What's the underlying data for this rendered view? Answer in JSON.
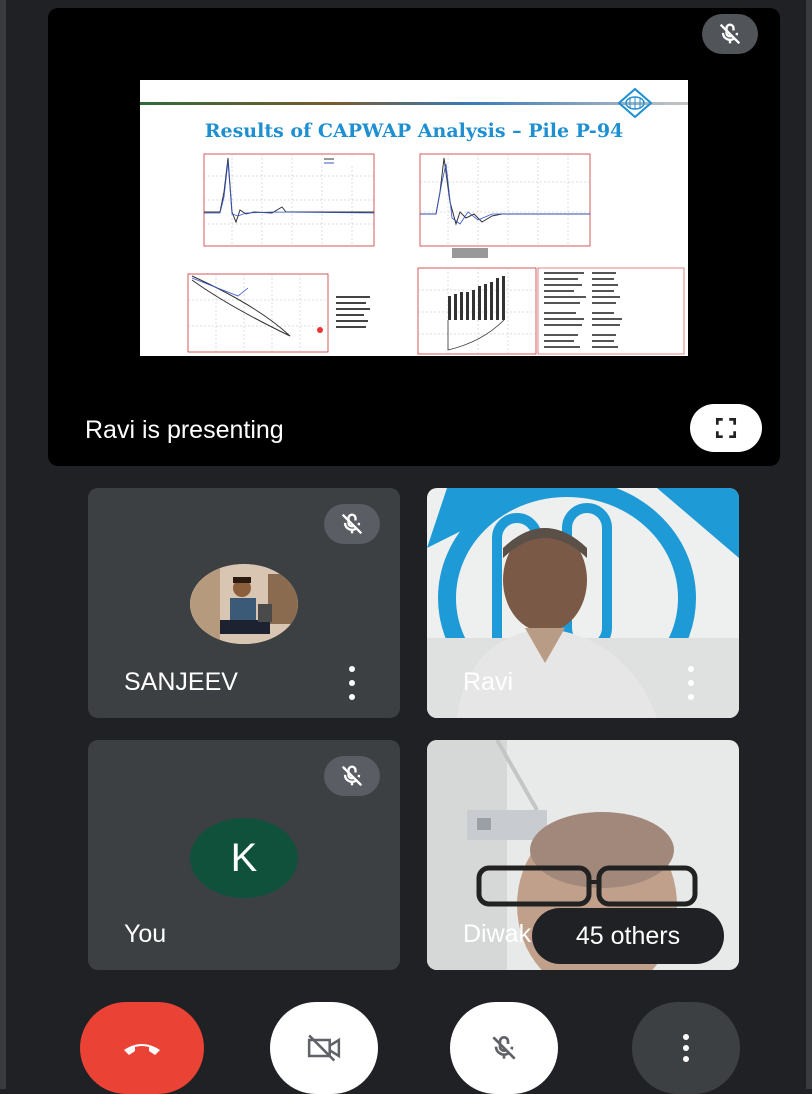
{
  "presentation": {
    "label": "Ravi is presenting",
    "slide": {
      "title": "Results of CAPWAP Analysis – Pile P-94"
    }
  },
  "participants": [
    {
      "name": "SANJEEV",
      "muted": true,
      "avatar": "photo"
    },
    {
      "name": "Ravi",
      "muted": false,
      "avatar": "video"
    },
    {
      "name": "You",
      "muted": true,
      "avatar": "letter",
      "initial": "K",
      "avatar_color": "#10513c"
    },
    {
      "name": "Diwak",
      "muted": false,
      "avatar": "video"
    }
  ],
  "others": {
    "label": "45 others"
  },
  "controls": {
    "hangup_icon": "phone-hangup-icon",
    "camera_icon": "camera-off-icon",
    "mic_icon": "mic-off-icon",
    "more_icon": "more-vertical-icon"
  },
  "colors": {
    "background": "#202124",
    "tile": "#3c4043",
    "hangup": "#ea4335",
    "accent_slide_title": "#1e8fd0"
  }
}
